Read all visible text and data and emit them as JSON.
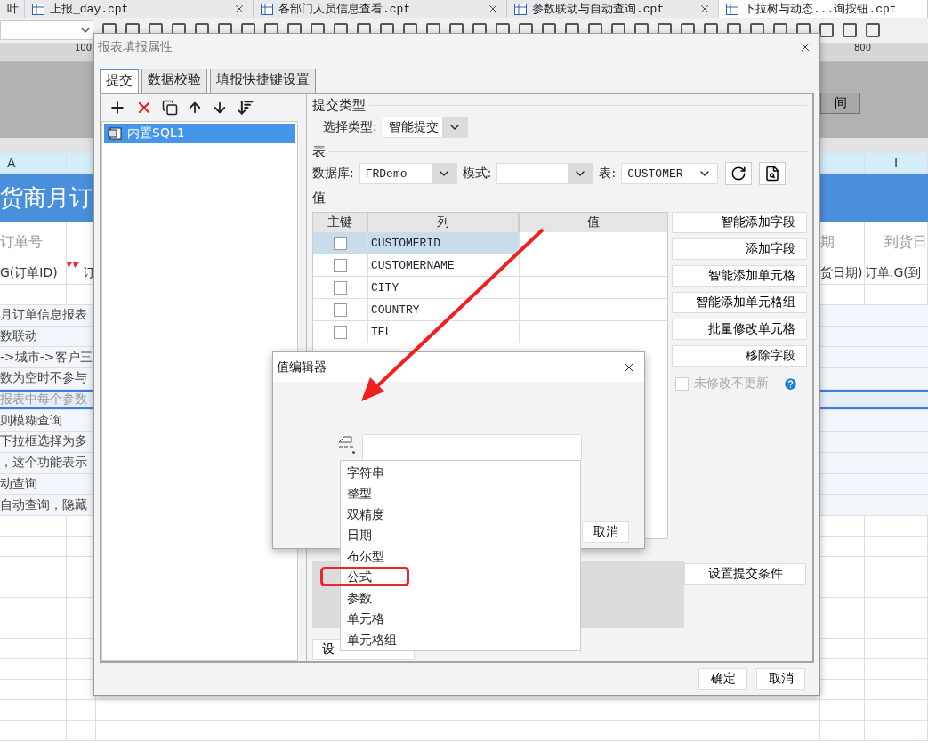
{
  "app_tabs": [
    {
      "kind": "partial",
      "label": "叶",
      "selected": false
    },
    {
      "kind": "file",
      "label": "上报_day.cpt",
      "selected": false
    },
    {
      "kind": "file",
      "label": "各部门人员信息查看.cpt",
      "selected": false
    },
    {
      "kind": "file",
      "label": "参数联动与自动查询.cpt",
      "selected": false
    },
    {
      "kind": "file",
      "label": "下拉树与动态...询按钮.cpt",
      "selected": true
    }
  ],
  "ruler": [
    "100",
    "800"
  ],
  "query_button": "间",
  "sheet": {
    "column_headers": [
      "A",
      "I"
    ],
    "title": "货商月订",
    "header_row": [
      "订单号",
      "期",
      "到货日"
    ],
    "field_row": [
      "G(订单ID)",
      "订",
      "货日期)",
      "订单.G(到"
    ],
    "notes": [
      {
        "text": "月订单信息报表",
        "highlighted": false
      },
      {
        "text": "数联动",
        "highlighted": false
      },
      {
        "text": "->城市->客户三",
        "highlighted": false
      },
      {
        "text": "数为空时不参与",
        "highlighted": false
      },
      {
        "text": "报表中每个参数",
        "highlighted": true
      },
      {
        "text": "则模糊查询",
        "highlighted": false
      },
      {
        "text": "下拉框选择为多",
        "highlighted": false
      },
      {
        "text": "，这个功能表示",
        "highlighted": false
      },
      {
        "text": "动查询",
        "highlighted": false
      },
      {
        "text": "自动查询，隐藏",
        "highlighted": false
      }
    ]
  },
  "dialog": {
    "title": "报表填报属性",
    "tabs": [
      {
        "label": "提交",
        "selected": true
      },
      {
        "label": "数据校验",
        "selected": false
      },
      {
        "label": "填报快捷键设置",
        "selected": false
      }
    ],
    "submissions": [
      {
        "label": "内置SQL1",
        "selected": true
      }
    ],
    "submit_type": {
      "group": "提交类型",
      "label": "选择类型:",
      "value": "智能提交"
    },
    "table": {
      "group": "表",
      "database_label": "数据库:",
      "database": "FRDemo",
      "schema_label": "模式:",
      "table_label": "表:",
      "table": "CUSTOMER"
    },
    "values": {
      "group": "值",
      "columns": [
        "主键",
        "列",
        "值"
      ],
      "rows": [
        {
          "column": "CUSTOMERID",
          "checked": false,
          "selected": true
        },
        {
          "column": "CUSTOMERNAME",
          "checked": false,
          "selected": false
        },
        {
          "column": "CITY",
          "checked": false,
          "selected": false
        },
        {
          "column": "COUNTRY",
          "checked": false,
          "selected": false
        },
        {
          "column": "TEL",
          "checked": false,
          "selected": false
        }
      ],
      "actions": [
        "智能添加字段",
        "添加字段",
        "智能添加单元格",
        "智能添加单元格组",
        "批量修改单元格",
        "移除字段"
      ],
      "skip_unchanged": {
        "label": "未修改不更新",
        "checked": false,
        "disabled": true
      }
    },
    "condition_button": "设置提交条件",
    "partial_button": "设",
    "footer_buttons": [
      "确定",
      "取消"
    ]
  },
  "value_editor": {
    "title": "值编辑器",
    "cancel": "取消",
    "type_options": [
      {
        "label": "字符串",
        "annotated": false
      },
      {
        "label": "整型",
        "annotated": false
      },
      {
        "label": "双精度",
        "annotated": false
      },
      {
        "label": "日期",
        "annotated": false
      },
      {
        "label": "布尔型",
        "annotated": false
      },
      {
        "label": "公式",
        "annotated": true
      },
      {
        "label": "参数",
        "annotated": false
      },
      {
        "label": "单元格",
        "annotated": false
      },
      {
        "label": "单元格组",
        "annotated": false
      }
    ]
  }
}
